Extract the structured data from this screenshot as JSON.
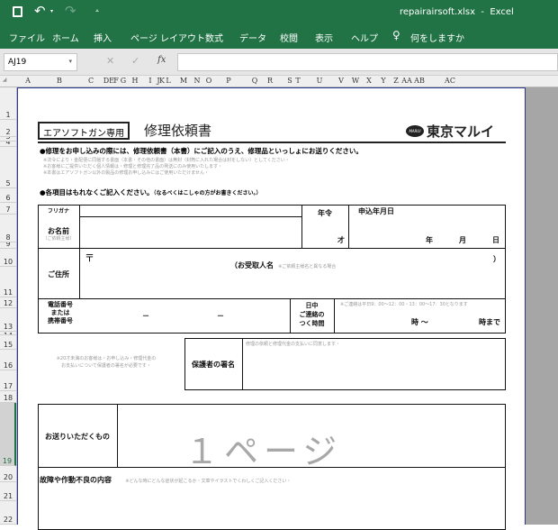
{
  "window": {
    "title": "repairairsoft.xlsx  -  Excel"
  },
  "ribbon": {
    "tabs": [
      "ファイル",
      "ホーム",
      "挿入",
      "ページ レイアウト",
      "数式",
      "データ",
      "校閲",
      "表示",
      "ヘルプ"
    ],
    "tell_me": "何をしますか"
  },
  "formula_bar": {
    "name_box": "AJ19",
    "fx": "fx",
    "formula": ""
  },
  "columns": [
    "A",
    "B",
    "C",
    "D",
    "E",
    "F",
    "G",
    "H",
    "I",
    "J",
    "K",
    "L",
    "M",
    "N",
    "O",
    "P",
    "Q",
    "R",
    "S",
    "T",
    "U",
    "V",
    "W",
    "X",
    "Y",
    "Z",
    "AA",
    "AB",
    "AC"
  ],
  "rows": [
    "1",
    "2",
    "3",
    "4",
    "5",
    "6",
    "7",
    "8",
    "9",
    "10",
    "11",
    "12",
    "13",
    "14",
    "15",
    "16",
    "17",
    "18",
    "19",
    "20",
    "21",
    "22"
  ],
  "form": {
    "badge": "エアソフトガン専用",
    "title": "修理依頼書",
    "brand": "東京マルイ",
    "brand_logo": "MARUI",
    "notice1": "●修理をお申し込みの際には、修理依頼書（本書）にご記入のうえ、修理品といっしょにお送りください。",
    "notes": [
      "※法令により・金配便に同梱する書面（本書・その他の書面）は無封（封筒に入れた場合は封をしない）としてください・",
      "※お客様にご提供いただく個人情報は・修理と修理完了品の発送にのみ使用いたします・",
      "※本書はエアソフトガン以外の製品の修理お申し込みにはご使用いただけません・"
    ],
    "notice2": "●各項目はもれなくご記入ください。",
    "notice2_sub": "（なるべくはこしゃの方がお書きください。）",
    "furigana": "フリガナ",
    "name": "お名前",
    "name_sub": "（ご依頼主様）",
    "age": "年令",
    "age_unit": "才",
    "date": "申込年月日",
    "year": "年",
    "month": "月",
    "day": "日",
    "address": "ご住所",
    "postal": "〒",
    "recipient": "（お受取人名",
    "recipient_note": "※ご依頼主様名と異なる場合",
    "close_paren": "）",
    "phone": "電話番号\nまたは\n携帯番号",
    "dash": "－",
    "contact": "日中\nご連絡の\nつく時間",
    "contact_note": "※ご連絡は平日9：00～12：00・13：00～17：30となります",
    "from": "時 ～",
    "to": "時まで",
    "minor_note": "※20才未満のお客様は・お申し込み・修理代金の\nお支払いについて保護者の署名が必要です・",
    "guardian": "保護者の署名",
    "guardian_note": "修理の依頼と修理代金の支払いに同意します・",
    "items": "お送りいただくもの",
    "watermark": "１ページ",
    "problem": "故障や作動不良の内容",
    "problem_note": "※どんな時にどんな症状が起こるか・文章やイラストでくわしくご記入ください・"
  }
}
